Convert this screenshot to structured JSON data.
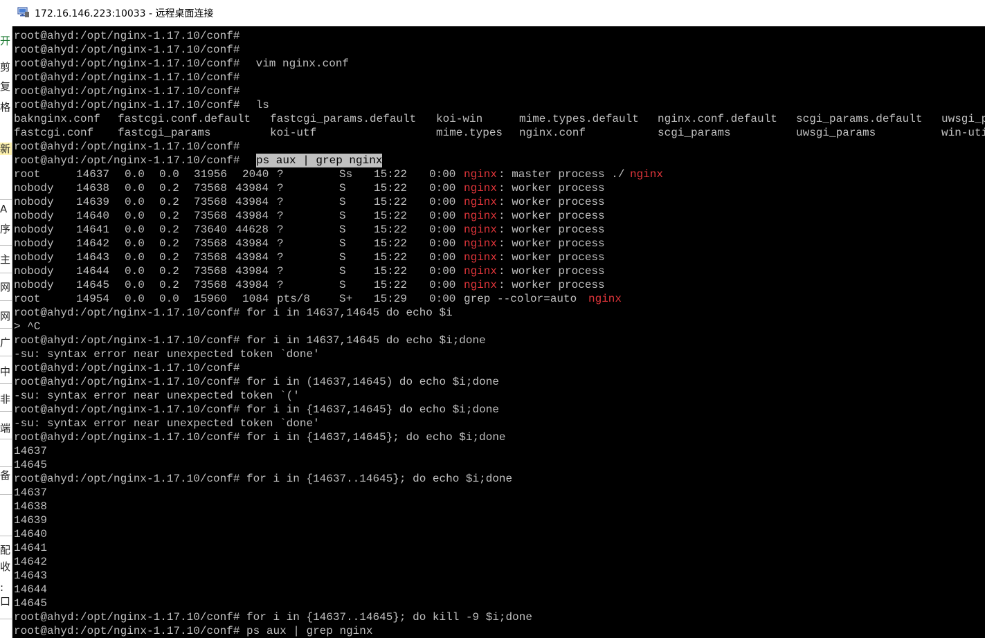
{
  "window": {
    "title": "172.16.146.223:10033 - 远程桌面连接",
    "icon": "remote-desktop-icon"
  },
  "left_strip": {
    "chars": [
      "开",
      "剪",
      "复",
      "格",
      "新",
      "A",
      "序",
      "主",
      "网",
      "网",
      "广",
      "中",
      "非",
      "端",
      "备",
      "配",
      "收",
      ":",
      "口"
    ]
  },
  "terminal": {
    "prompt": "root@ahyd:/opt/nginx-1.17.10/conf#",
    "lines": [
      {
        "prompt": "root@ahyd:/opt/nginx-1.17.10/conf#",
        "cmd": ""
      },
      {
        "prompt": "root@ahyd:/opt/nginx-1.17.10/conf#",
        "cmd": ""
      },
      {
        "prompt": "root@ahyd:/opt/nginx-1.17.10/conf#",
        "cmd": " vim nginx.conf"
      },
      {
        "prompt": "root@ahyd:/opt/nginx-1.17.10/conf#",
        "cmd": ""
      },
      {
        "prompt": "root@ahyd:/opt/nginx-1.17.10/conf#",
        "cmd": ""
      },
      {
        "prompt": "root@ahyd:/opt/nginx-1.17.10/conf#",
        "cmd": " ls"
      }
    ],
    "ls_rows": [
      [
        "baknginx.conf",
        "fastcgi.conf.default",
        "fastcgi_params.default",
        "koi-win",
        "mime.types.default",
        "nginx.conf.default",
        "scgi_params.default",
        "uwsgi_p"
      ],
      [
        "fastcgi.conf",
        "fastcgi_params",
        "",
        "koi-utf",
        "mime.types",
        "nginx.conf",
        "scgi_params",
        "uwsgi_params",
        "win-uti"
      ]
    ],
    "after_ls": [
      {
        "prompt": "root@ahyd:/opt/nginx-1.17.10/conf#",
        "cmd": ""
      }
    ],
    "ps_command": {
      "prompt": "root@ahyd:/opt/nginx-1.17.10/conf#",
      "cmd": "ps aux | grep nginx"
    },
    "ps_rows": [
      {
        "user": "root",
        "pid": "14637",
        "cpu": "0.0",
        "mem": "0.0",
        "vsz": "31956",
        "rss": "2040",
        "tty": "?",
        "stat": "Ss",
        "start": "15:22",
        "time": "0:00",
        "cmd_pre": "",
        "cmd_red": "nginx",
        "cmd_post": ": master process ./",
        "cmd_red2": "nginx"
      },
      {
        "user": "nobody",
        "pid": "14638",
        "cpu": "0.0",
        "mem": "0.2",
        "vsz": "73568",
        "rss": "43984",
        "tty": "?",
        "stat": "S",
        "start": "15:22",
        "time": "0:00",
        "cmd_pre": "",
        "cmd_red": "nginx",
        "cmd_post": ": worker process",
        "cmd_red2": ""
      },
      {
        "user": "nobody",
        "pid": "14639",
        "cpu": "0.0",
        "mem": "0.2",
        "vsz": "73568",
        "rss": "43984",
        "tty": "?",
        "stat": "S",
        "start": "15:22",
        "time": "0:00",
        "cmd_pre": "",
        "cmd_red": "nginx",
        "cmd_post": ": worker process",
        "cmd_red2": ""
      },
      {
        "user": "nobody",
        "pid": "14640",
        "cpu": "0.0",
        "mem": "0.2",
        "vsz": "73568",
        "rss": "43984",
        "tty": "?",
        "stat": "S",
        "start": "15:22",
        "time": "0:00",
        "cmd_pre": "",
        "cmd_red": "nginx",
        "cmd_post": ": worker process",
        "cmd_red2": ""
      },
      {
        "user": "nobody",
        "pid": "14641",
        "cpu": "0.0",
        "mem": "0.2",
        "vsz": "73640",
        "rss": "44628",
        "tty": "?",
        "stat": "S",
        "start": "15:22",
        "time": "0:00",
        "cmd_pre": "",
        "cmd_red": "nginx",
        "cmd_post": ": worker process",
        "cmd_red2": ""
      },
      {
        "user": "nobody",
        "pid": "14642",
        "cpu": "0.0",
        "mem": "0.2",
        "vsz": "73568",
        "rss": "43984",
        "tty": "?",
        "stat": "S",
        "start": "15:22",
        "time": "0:00",
        "cmd_pre": "",
        "cmd_red": "nginx",
        "cmd_post": ": worker process",
        "cmd_red2": ""
      },
      {
        "user": "nobody",
        "pid": "14643",
        "cpu": "0.0",
        "mem": "0.2",
        "vsz": "73568",
        "rss": "43984",
        "tty": "?",
        "stat": "S",
        "start": "15:22",
        "time": "0:00",
        "cmd_pre": "",
        "cmd_red": "nginx",
        "cmd_post": ": worker process",
        "cmd_red2": ""
      },
      {
        "user": "nobody",
        "pid": "14644",
        "cpu": "0.0",
        "mem": "0.2",
        "vsz": "73568",
        "rss": "43984",
        "tty": "?",
        "stat": "S",
        "start": "15:22",
        "time": "0:00",
        "cmd_pre": "",
        "cmd_red": "nginx",
        "cmd_post": ": worker process",
        "cmd_red2": ""
      },
      {
        "user": "nobody",
        "pid": "14645",
        "cpu": "0.0",
        "mem": "0.2",
        "vsz": "73568",
        "rss": "43984",
        "tty": "?",
        "stat": "S",
        "start": "15:22",
        "time": "0:00",
        "cmd_pre": "",
        "cmd_red": "nginx",
        "cmd_post": ": worker process",
        "cmd_red2": ""
      },
      {
        "user": "root",
        "pid": "14954",
        "cpu": "0.0",
        "mem": "0.0",
        "vsz": "15960",
        "rss": "1084",
        "tty": "pts/8",
        "stat": "S+",
        "start": "15:29",
        "time": "0:00",
        "cmd_pre": "grep --color=auto ",
        "cmd_red": "nginx",
        "cmd_post": "",
        "cmd_red2": ""
      }
    ],
    "tail_lines": [
      "root@ahyd:/opt/nginx-1.17.10/conf# for i in 14637,14645 do echo $i",
      "> ^C",
      "root@ahyd:/opt/nginx-1.17.10/conf# for i in 14637,14645 do echo $i;done",
      "-su: syntax error near unexpected token `done'",
      "root@ahyd:/opt/nginx-1.17.10/conf#",
      "root@ahyd:/opt/nginx-1.17.10/conf# for i in (14637,14645) do echo $i;done",
      "-su: syntax error near unexpected token `('",
      "root@ahyd:/opt/nginx-1.17.10/conf# for i in {14637,14645} do echo $i;done",
      "-su: syntax error near unexpected token `done'",
      "root@ahyd:/opt/nginx-1.17.10/conf# for i in {14637,14645}; do echo $i;done",
      "14637",
      "14645",
      "root@ahyd:/opt/nginx-1.17.10/conf# for i in {14637..14645}; do echo $i;done",
      "14637",
      "14638",
      "14639",
      "14640",
      "14641",
      "14642",
      "14643",
      "14644",
      "14645",
      "root@ahyd:/opt/nginx-1.17.10/conf# for i in {14637..14645}; do kill -9 $i;done",
      "root@ahyd:/opt/nginx-1.17.10/conf# ps aux | grep nginx"
    ]
  },
  "colors": {
    "terminal_bg": "#000000",
    "terminal_fg": "#c0c0c0",
    "highlight_red": "#e0353a",
    "selection_bg": "#c0c0c0"
  }
}
